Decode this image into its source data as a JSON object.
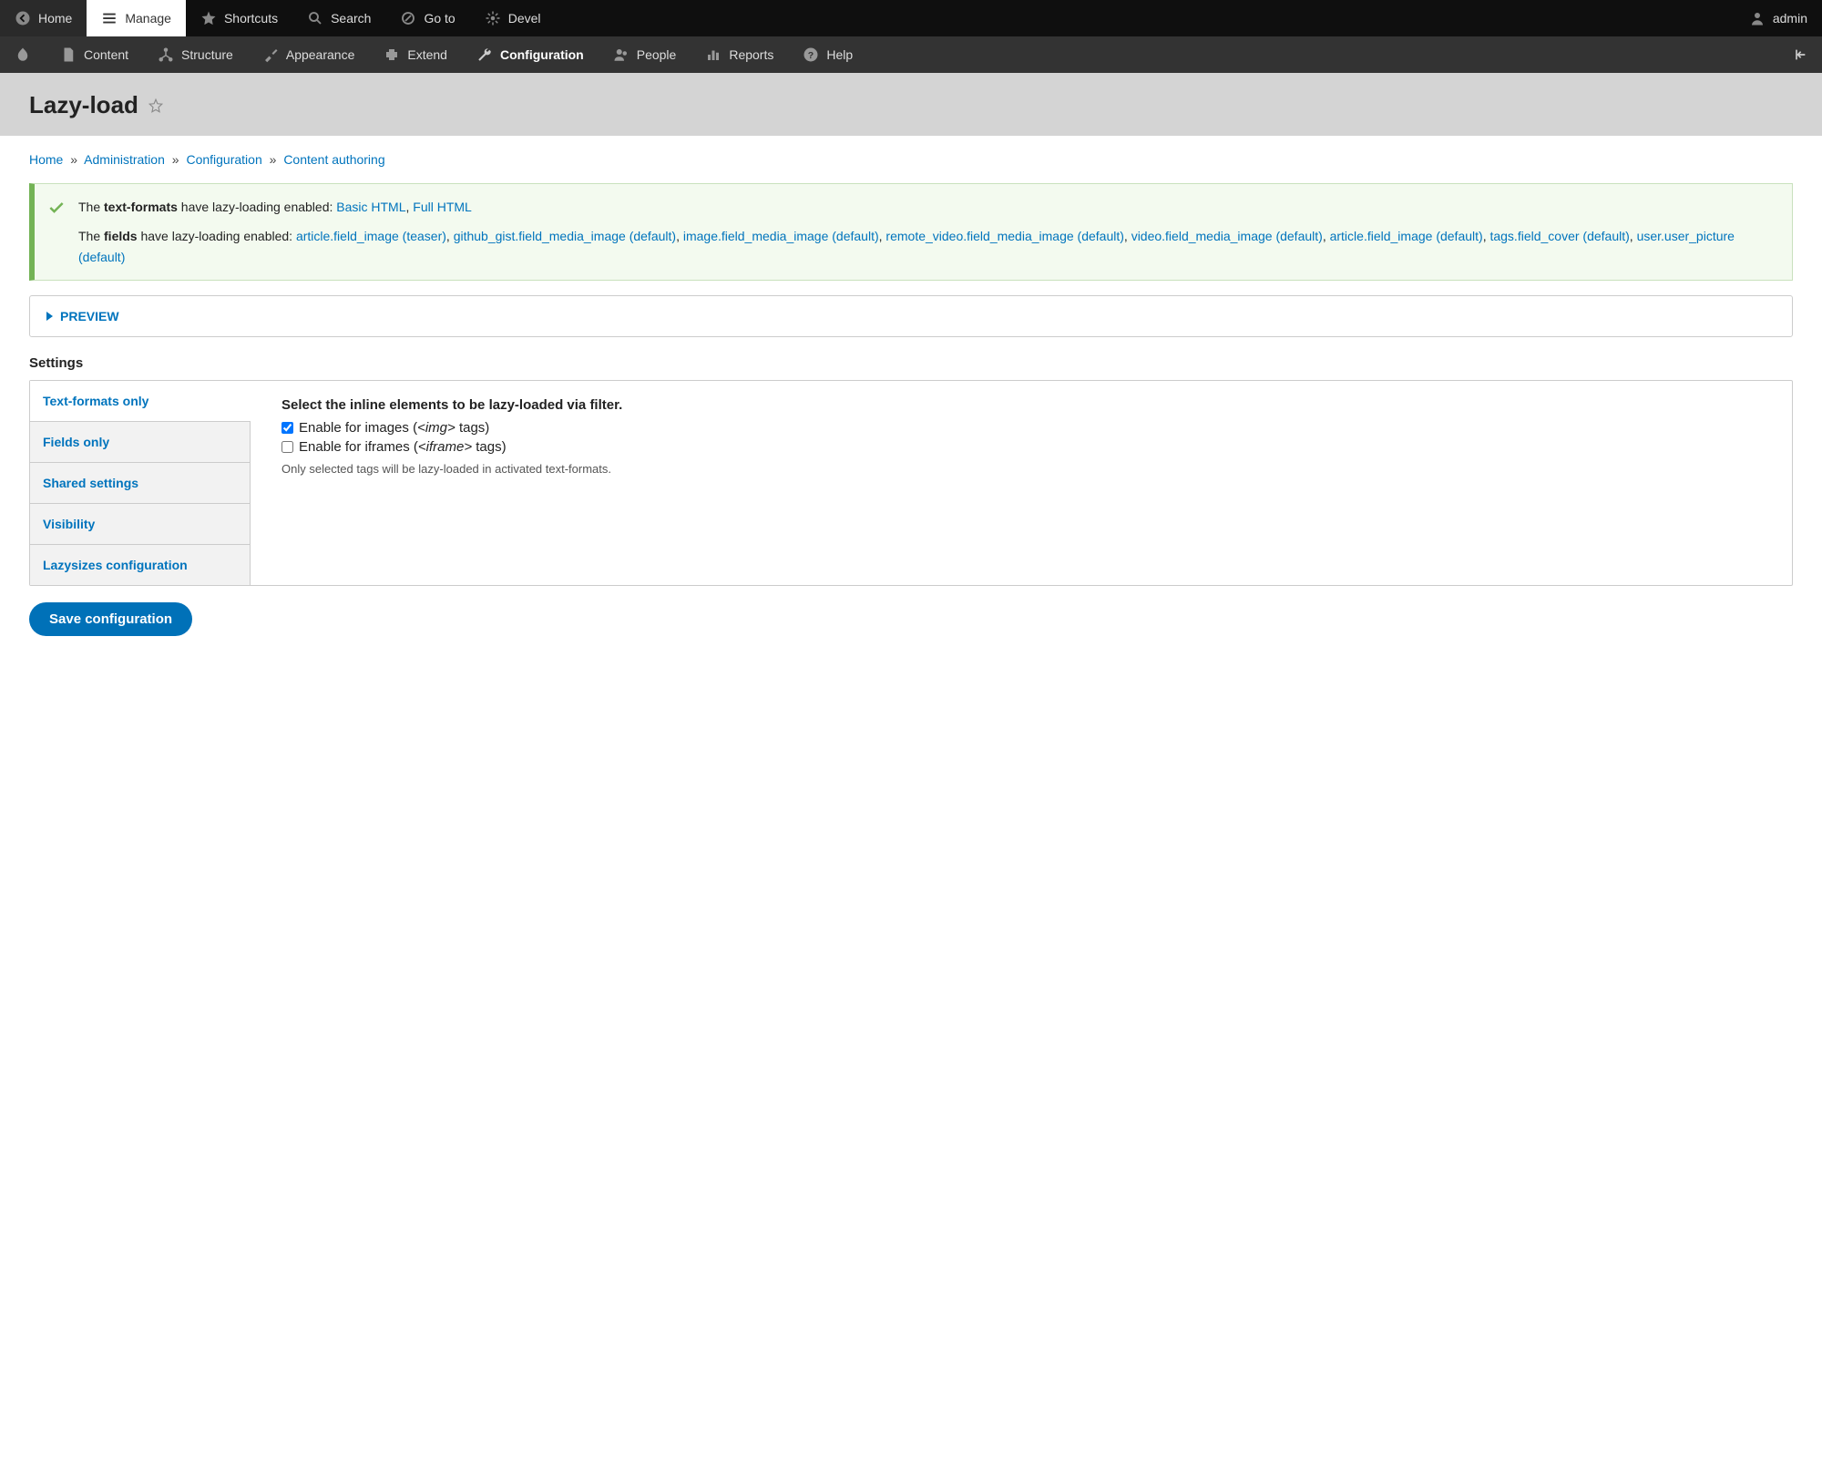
{
  "toolbar": {
    "home": "Home",
    "manage": "Manage",
    "shortcuts": "Shortcuts",
    "search": "Search",
    "goto": "Go to",
    "devel": "Devel",
    "user": "admin"
  },
  "admin_menu": {
    "content": "Content",
    "structure": "Structure",
    "appearance": "Appearance",
    "extend": "Extend",
    "configuration": "Configuration",
    "people": "People",
    "reports": "Reports",
    "help": "Help"
  },
  "page": {
    "title": "Lazy-load"
  },
  "breadcrumb": {
    "home": "Home",
    "administration": "Administration",
    "configuration": "Configuration",
    "content_authoring": "Content authoring"
  },
  "status": {
    "line1_pre": "The ",
    "line1_strong": "text-formats",
    "line1_mid": " have lazy-loading enabled: ",
    "formats": [
      "Basic HTML",
      "Full HTML"
    ],
    "line2_pre": "The ",
    "line2_strong": "fields",
    "line2_mid": " have lazy-loading enabled: ",
    "fields_list": [
      "article.field_image (teaser)",
      "github_gist.field_media_image (default)",
      "image.field_media_image (default)",
      "remote_video.field_media_image (default)",
      "video.field_media_image (default)",
      "article.field_image (default)",
      "tags.field_cover (default)",
      "user.user_picture (default)"
    ]
  },
  "preview": {
    "label": "PREVIEW"
  },
  "settings": {
    "label": "Settings",
    "tabs": {
      "text_formats": "Text-formats only",
      "fields_only": "Fields only",
      "shared": "Shared settings",
      "visibility": "Visibility",
      "lazysizes": "Lazysizes configuration"
    },
    "pane": {
      "title": "Select the inline elements to be lazy-loaded via filter.",
      "enable_images_pre": "Enable for images (",
      "enable_images_tag": "<img>",
      "enable_images_suf": " tags)",
      "enable_iframes_pre": "Enable for iframes (",
      "enable_iframes_tag": "<iframe>",
      "enable_iframes_suf": " tags)",
      "desc": "Only selected tags will be lazy-loaded in activated text-formats."
    }
  },
  "actions": {
    "save": "Save configuration"
  }
}
